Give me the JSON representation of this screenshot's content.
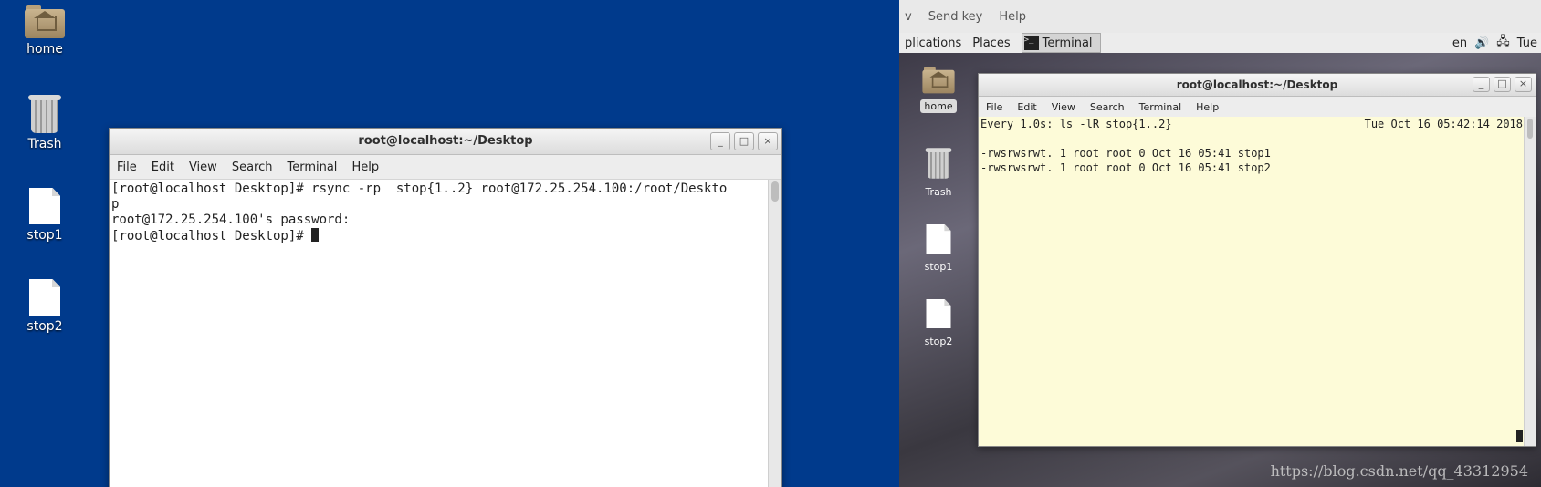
{
  "left_desktop": {
    "icons": [
      {
        "label": "home"
      },
      {
        "label": "Trash"
      },
      {
        "label": "stop1"
      },
      {
        "label": "stop2"
      }
    ],
    "terminal": {
      "title": "root@localhost:~/Desktop",
      "menu": [
        "File",
        "Edit",
        "View",
        "Search",
        "Terminal",
        "Help"
      ],
      "lines": [
        "[root@localhost Desktop]# rsync -rp  stop{1..2} root@172.25.254.100:/root/Deskto",
        "p",
        "root@172.25.254.100's password:",
        "[root@localhost Desktop]# "
      ],
      "buttons": {
        "minimize": "_",
        "maximize": "□",
        "close": "×"
      }
    }
  },
  "right_panel": {
    "viewer_menu": [
      "v",
      "Send key",
      "Help"
    ],
    "gnome_bar": {
      "applications": "plications",
      "places": "Places",
      "task": "Terminal",
      "lang": "en",
      "clock": "Tue"
    },
    "icons": [
      {
        "label": "home"
      },
      {
        "label": "Trash"
      },
      {
        "label": "stop1"
      },
      {
        "label": "stop2"
      }
    ],
    "terminal": {
      "title": "root@localhost:~/Desktop",
      "menu": [
        "File",
        "Edit",
        "View",
        "Search",
        "Terminal",
        "Help"
      ],
      "header_left": "Every 1.0s: ls -lR stop{1..2}",
      "header_right": "Tue Oct 16 05:42:14 2018",
      "lines": [
        "-rwsrwsrwt. 1 root root 0 Oct 16 05:41 stop1",
        "-rwsrwsrwt. 1 root root 0 Oct 16 05:41 stop2"
      ],
      "buttons": {
        "minimize": "_",
        "maximize": "□",
        "close": "×"
      }
    },
    "watermark": "https://blog.csdn.net/qq_43312954"
  }
}
